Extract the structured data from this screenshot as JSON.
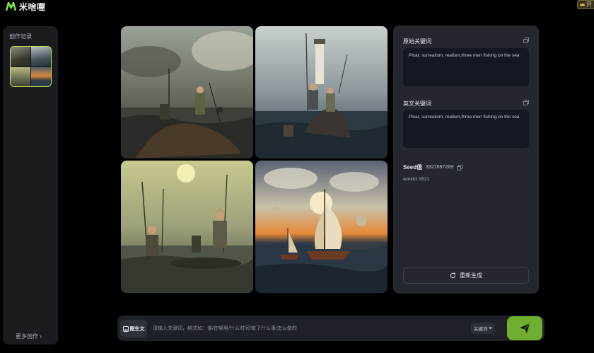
{
  "app": {
    "logo_text": "米啥喔",
    "top_right_label": "开"
  },
  "sidebar": {
    "title": "创作记录",
    "more_label": "更多创作 ›"
  },
  "gallery": {
    "images": [
      {
        "name": "three-men-fishing-rocks"
      },
      {
        "name": "men-fishing-lighthouse"
      },
      {
        "name": "men-fishing-yellow-sun"
      },
      {
        "name": "sailboats-sunset"
      }
    ]
  },
  "panel": {
    "original_label": "原始关键词",
    "original_text": "Pixar, surrealism, realism,three men fishing on the sea",
    "english_label": "英文关键词",
    "english_text": "Pixar, surrealism, realism,three men fishing on the sea",
    "seed_label": "Seed值",
    "seed_value": "3321697269",
    "worker_text": "workId: 9521",
    "regenerate_label": "重新生成"
  },
  "inputbar": {
    "img2txt_label": "图生文",
    "placeholder": "请输入关键词，格式如：谁/在哪里/什么时间/做了什么事/怎么做的",
    "value": "",
    "mode_label": "关键词"
  },
  "colors": {
    "accent": "#6fae2e",
    "selected_border": "#c6e84a",
    "panel_bg": "#24272d"
  }
}
